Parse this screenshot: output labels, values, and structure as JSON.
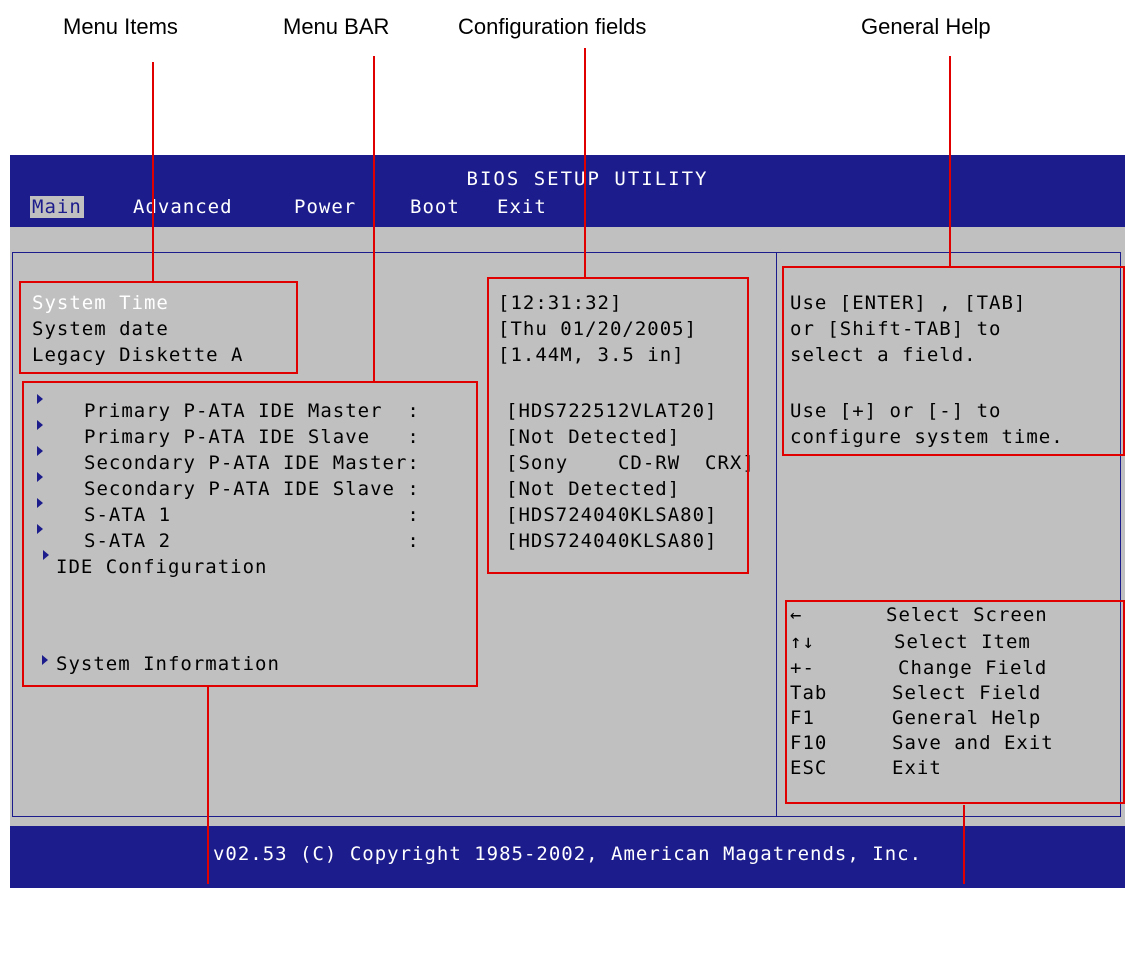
{
  "callouts": {
    "menu_items": "Menu Items",
    "menu_bar": "Menu BAR",
    "config_fields": "Configuration fields",
    "general_help": "General Help"
  },
  "bios": {
    "title": "BIOS SETUP UTILITY",
    "menu": [
      "Main",
      "Advanced",
      "Power",
      "Boot",
      "Exit"
    ],
    "selected_menu": "Main",
    "items": [
      {
        "label": "System Time",
        "value": "[12:31:32]"
      },
      {
        "label": "System date",
        "value": "[Thu 01/20/2005]"
      },
      {
        "label": "Legacy Diskette A",
        "value": "[1.44M, 3.5 in]"
      }
    ],
    "submenus": [
      {
        "label": "Primary P-ATA IDE Master  :",
        "value": "[HDS722512VLAT20]"
      },
      {
        "label": "Primary P-ATA IDE Slave   :",
        "value": "[Not Detected]"
      },
      {
        "label": "Secondary P-ATA IDE Master:",
        "value": "[Sony    CD-RW  CRX]"
      },
      {
        "label": "Secondary P-ATA IDE Slave :",
        "value": "[Not Detected]"
      },
      {
        "label": "S-ATA 1                   :",
        "value": "[HDS724040KLSA80]"
      },
      {
        "label": "S-ATA 2                   :",
        "value": "[HDS724040KLSA80]"
      }
    ],
    "ide_config": "IDE Configuration",
    "system_info": "System Information",
    "help": [
      "Use [ENTER] , [TAB]",
      "or [Shift-TAB] to",
      "select a field.",
      "",
      "Use [+] or [-] to",
      "configure system time."
    ],
    "keys": [
      {
        "key": "←",
        "desc": "Select Screen"
      },
      {
        "key": "↑↓",
        "desc": "Select Item"
      },
      {
        "key": "+-",
        "desc": "Change Field"
      },
      {
        "key": "Tab",
        "desc": "Select Field"
      },
      {
        "key": "F1",
        "desc": "General Help"
      },
      {
        "key": "F10",
        "desc": "Save and Exit"
      },
      {
        "key": "ESC",
        "desc": "Exit"
      }
    ],
    "footer": "v02.53 (C) Copyright 1985-2002, American Magatrends, Inc."
  },
  "colors": {
    "bios_blue": "#1c1c8c",
    "bios_gray": "#c0c0c0",
    "callout_red": "#e00000"
  }
}
